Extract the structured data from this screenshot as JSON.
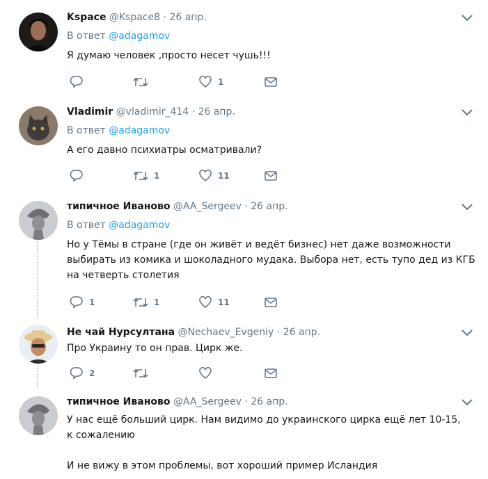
{
  "reply_prefix": "В ответ",
  "tweets": [
    {
      "name": "Kspace",
      "handle": "@Kspace8",
      "date": "26 апр.",
      "reply_to": "@adagamov",
      "text": "Я думаю человек ,просто несет чушь!!!",
      "replies": "",
      "retweets": "",
      "likes": "1"
    },
    {
      "name": "Vladimir",
      "handle": "@vladimir_414",
      "date": "26 апр.",
      "reply_to": "@adagamov",
      "text": "А его давно психиатры осматривали?",
      "replies": "",
      "retweets": "1",
      "likes": "11"
    },
    {
      "name": "типичное Иваново",
      "handle": "@AA_Sergeev",
      "date": "26 апр.",
      "reply_to": "@adagamov",
      "text_lines": [
        "Но у Тёмы в стране (где он живёт и ведёт бизнес) нет даже возможности",
        "выбирать из комика и шоколадного мудака. Выбора нет, есть тупо дед из КГБ",
        "на четверть столетия"
      ],
      "replies": "1",
      "retweets": "1",
      "likes": "11"
    },
    {
      "name": "Не чай Нурсултана",
      "handle": "@Nechaev_Evgeniy",
      "date": "26 апр.",
      "text": "Про Украину то он прав. Цирк же.",
      "replies": "2",
      "retweets": "",
      "likes": ""
    },
    {
      "name": "типичное Иваново",
      "handle": "@AA_Sergeev",
      "date": "26 апр.",
      "text_lines": [
        "У нас ещё больший цирк. Нам видимо до украинского цирка ещё лет 10-15,",
        "к сожалению",
        "",
        "И не вижу в этом проблемы, вот хороший пример Исландия"
      ]
    }
  ],
  "colors": {
    "link": "#1da1f2",
    "secondary": "#657786",
    "border": "#e6ecf0",
    "text": "#14171a"
  },
  "icons": [
    "reply-icon",
    "retweet-icon",
    "like-icon",
    "message-icon",
    "caret-down-icon"
  ]
}
